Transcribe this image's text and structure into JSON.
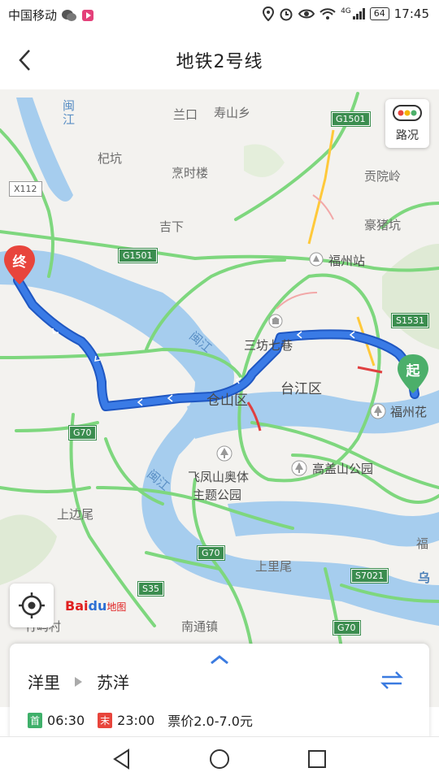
{
  "status_bar": {
    "carrier": "中国移动",
    "network": "4G",
    "battery": "64",
    "time": "17:45"
  },
  "header": {
    "title": "地铁2号线"
  },
  "map": {
    "traffic_label": "路况",
    "start_marker": "起",
    "end_marker": "终",
    "logo_text": "Bai",
    "logo_du": "du",
    "logo_suffix": "地图",
    "places": [
      "兰口",
      "寿山乡",
      "杞坑",
      "烹时楼",
      "贡院岭",
      "吉下",
      "豪猪坑",
      "福州站",
      "三坊七巷",
      "台江区",
      "仓山区",
      "福州花",
      "飞凤山奥体",
      "主题公园",
      "高盖山公园",
      "上边尾",
      "上里尾",
      "福",
      "乌",
      "南通镇",
      "竹屿村"
    ],
    "rivers": [
      "闽江",
      "闽江",
      "闽江"
    ],
    "road_shields": [
      "G1501",
      "X112",
      "G1501",
      "S1531",
      "G70",
      "G70",
      "S35",
      "S7021",
      "G70"
    ]
  },
  "line_card": {
    "from_station": "洋里",
    "to_station": "苏洋",
    "first_badge": "首",
    "first_time": "06:30",
    "last_badge": "末",
    "last_time": "23:00",
    "fare": "票价2.0-7.0元"
  },
  "colors": {
    "route": "#2f6fd8",
    "start_marker": "#4caf6a",
    "end_marker": "#e8453c",
    "first_badge": "#3fb06a",
    "last_badge": "#e8453c",
    "accent_blue": "#3b7be0"
  },
  "icons": [
    "wechat-icon",
    "location-icon",
    "alarm-icon",
    "eye-icon",
    "wifi-icon",
    "signal-icon",
    "back-icon",
    "traffic-icon",
    "locate-icon",
    "caret-up-icon",
    "swap-icon",
    "nav-back-icon",
    "nav-home-icon",
    "nav-recents-icon"
  ]
}
